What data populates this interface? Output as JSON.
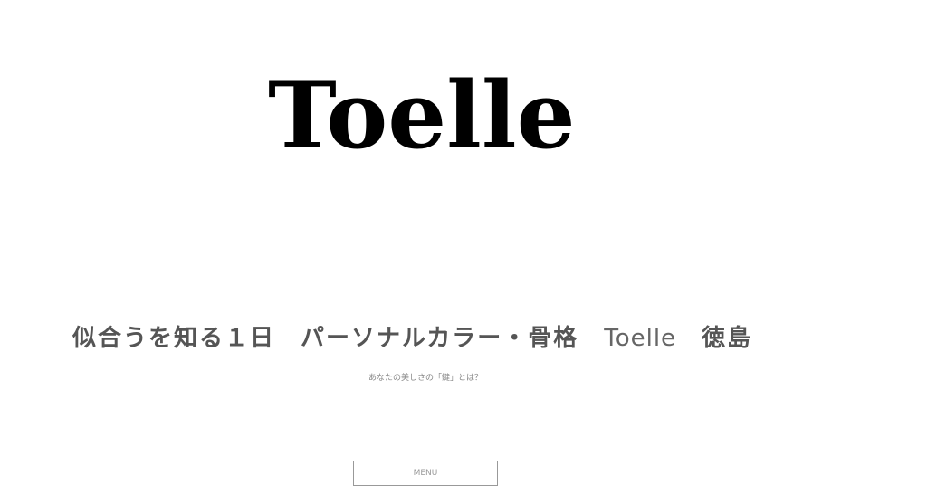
{
  "header": {
    "logo_text": "Toelle",
    "title_part1": "似合うを知る１日　パーソナルカラー・骨格　",
    "title_brand": "Toelle",
    "title_part2": "　徳島",
    "tagline": "あなたの美しさの「鍵」とは？"
  },
  "nav": {
    "menu_label": "MENU"
  },
  "colors": {
    "background": "#ffffff",
    "logo": "#000000",
    "title": "#555555",
    "divider": "#cccccc",
    "menu_border": "#999999"
  }
}
